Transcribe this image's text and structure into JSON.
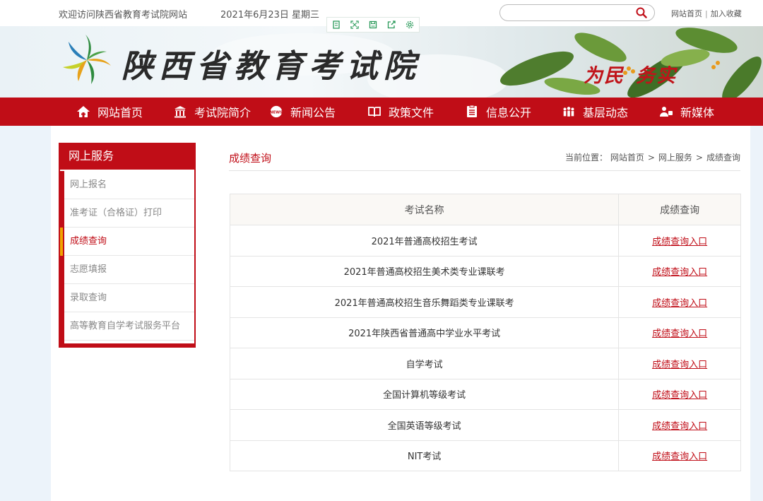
{
  "topbar": {
    "welcome": "欢迎访问陕西省教育考试院网站",
    "date": "2021年6月23日  星期三",
    "search_placeholder": "",
    "link_home": "网站首页",
    "link_fav": "加入收藏",
    "separator": "|"
  },
  "tools": [
    "page-icon",
    "fullscreen-icon",
    "save-icon",
    "share-icon",
    "settings-icon"
  ],
  "banner": {
    "site_name": "陕西省教育考试院",
    "slogan_1": "为民",
    "slogan_2": "务实"
  },
  "nav": [
    {
      "label": "网站首页",
      "icon": "home-icon"
    },
    {
      "label": "考试院简介",
      "icon": "building-icon"
    },
    {
      "label": "新闻公告",
      "icon": "news-icon"
    },
    {
      "label": "政策文件",
      "icon": "book-icon"
    },
    {
      "label": "信息公开",
      "icon": "document-icon"
    },
    {
      "label": "基层动态",
      "icon": "people-icon"
    },
    {
      "label": "新媒体",
      "icon": "media-icon"
    }
  ],
  "sidebar": {
    "title": "网上服务",
    "items": [
      {
        "label": "网上报名"
      },
      {
        "label": "准考证（合格证）打印"
      },
      {
        "label": "成绩查询",
        "active": true
      },
      {
        "label": "志愿填报"
      },
      {
        "label": "录取查询"
      },
      {
        "label": "高等教育自学考试服务平台"
      }
    ]
  },
  "content": {
    "title": "成绩查询",
    "breadcrumb": {
      "prefix": "当前位置：",
      "items": [
        "网站首页",
        "网上服务",
        "成绩查询"
      ],
      "sep": ">"
    },
    "table": {
      "headers": [
        "考试名称",
        "成绩查询"
      ],
      "rows": [
        {
          "name": "2021年普通高校招生考试",
          "link": "成绩查询入口"
        },
        {
          "name": "2021年普通高校招生美术类专业课联考",
          "link": "成绩查询入口"
        },
        {
          "name": "2021年普通高校招生音乐舞蹈类专业课联考",
          "link": "成绩查询入口"
        },
        {
          "name": "2021年陕西省普通高中学业水平考试",
          "link": "成绩查询入口"
        },
        {
          "name": "自学考试",
          "link": "成绩查询入口"
        },
        {
          "name": "全国计算机等级考试",
          "link": "成绩查询入口"
        },
        {
          "name": "全国英语等级考试",
          "link": "成绩查询入口"
        },
        {
          "name": "NIT考试",
          "link": "成绩查询入口"
        }
      ]
    }
  },
  "colors": {
    "brand_red": "#c00d17",
    "accent_orange": "#f0a500"
  }
}
